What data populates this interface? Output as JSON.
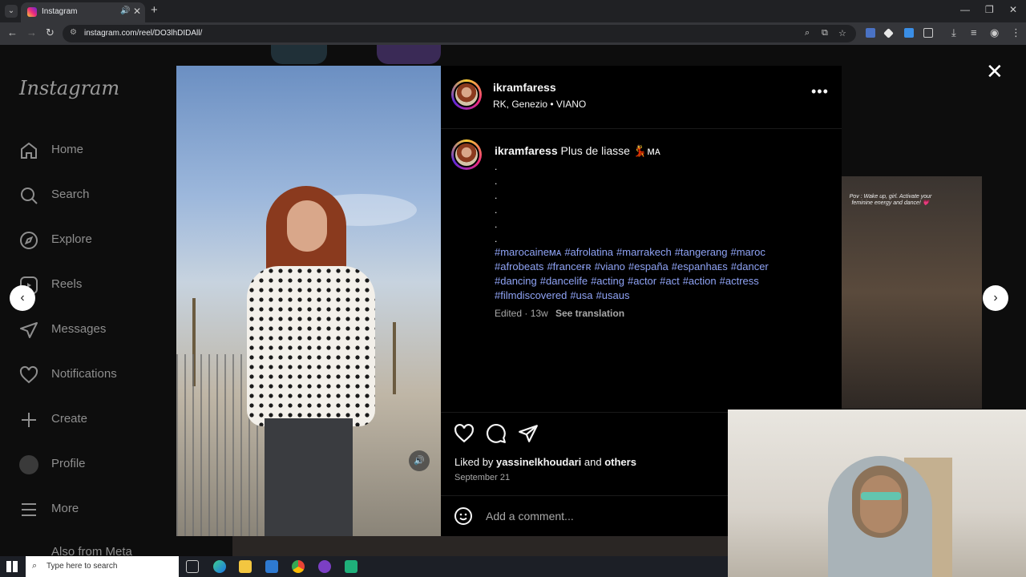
{
  "browser": {
    "tab_title": "Instagram",
    "url": "instagram.com/reel/DO3lhDIDAll/"
  },
  "sidebar": {
    "logo": "Instagram",
    "items": [
      {
        "label": "Home"
      },
      {
        "label": "Search"
      },
      {
        "label": "Explore"
      },
      {
        "label": "Reels"
      },
      {
        "label": "Messages"
      },
      {
        "label": "Notifications"
      },
      {
        "label": "Create"
      },
      {
        "label": "Profile"
      },
      {
        "label": "More"
      },
      {
        "label": "Also from Meta"
      }
    ]
  },
  "post": {
    "username": "ikramfaress",
    "location": "RK, Genezio • VIANO",
    "caption_text": "Plus de liasse 💃ᴍᴀ",
    "caption_dots": [
      ".",
      ".",
      ".",
      ".",
      ".",
      "."
    ],
    "hashtags": [
      "#marocaineᴍᴀ",
      "#afrolatina",
      "#marrakech",
      "#tangerang",
      "#maroc",
      "#afrobeats",
      "#franceғʀ",
      "#viano",
      "#españa",
      "#espanhaᴇs",
      "#dancer",
      "#dancing",
      "#dancelife",
      "#acting",
      "#actor",
      "#act",
      "#action",
      "#actress",
      "#filmdiscovered",
      "#usa",
      "#usaus"
    ],
    "meta": "Edited · 13w",
    "see_translation": "See translation",
    "liked_by_prefix": "Liked by",
    "liked_by_user": "yassinelkhoudari",
    "liked_by_and": "and",
    "liked_by_others": "others",
    "date": "September 21",
    "comment_placeholder": "Add a comment..."
  },
  "next_preview": {
    "caption": "Pov : Wake up, girl. Activate your feminine energy and dance! 💗"
  },
  "taskbar": {
    "search_placeholder": "Type here to search"
  },
  "colors": {
    "hashtag": "#8fa3f5",
    "panel_bg": "#000000",
    "backdrop": "#0d0d0d",
    "text": "#f5f5f5",
    "muted": "#a8a8a8"
  }
}
